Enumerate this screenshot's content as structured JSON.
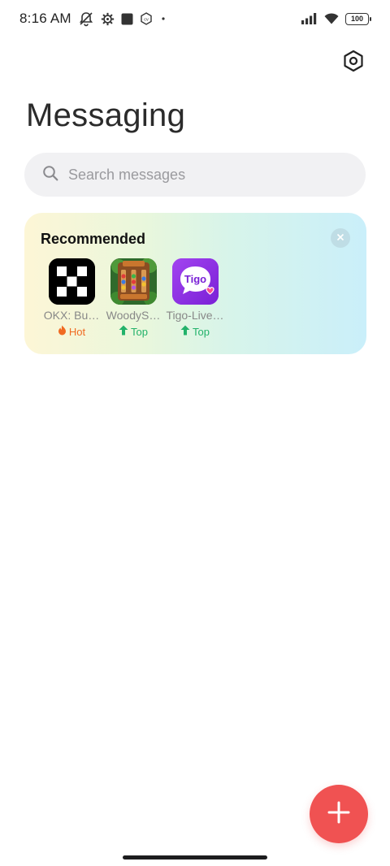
{
  "status_bar": {
    "time": "8:16 AM",
    "battery": "100",
    "icons": [
      "notifications-off-icon",
      "settings-gear-icon",
      "square-app-icon",
      "hexagon-app-icon",
      "dot-icon",
      "signal-icon",
      "wifi-icon",
      "battery-icon"
    ]
  },
  "header": {
    "title": "Messaging",
    "settings_icon": "settings-hexagon-icon"
  },
  "search": {
    "placeholder": "Search messages",
    "icon": "search-icon"
  },
  "recommended": {
    "title": "Recommended",
    "apps": [
      {
        "name": "OKX: Bu…",
        "badge": "Hot",
        "badge_icon": "flame-icon",
        "badge_color": "#f06a22"
      },
      {
        "name": "WoodyS…",
        "badge": "Top",
        "badge_icon": "arrow-up-icon",
        "badge_color": "#22b26a"
      },
      {
        "name": "Tigo-Live…",
        "badge": "Top",
        "badge_icon": "arrow-up-icon",
        "badge_color": "#22b26a"
      }
    ],
    "tigo_logo": "Tigo"
  },
  "fab": {
    "icon": "plus-icon",
    "color": "#f05252"
  }
}
